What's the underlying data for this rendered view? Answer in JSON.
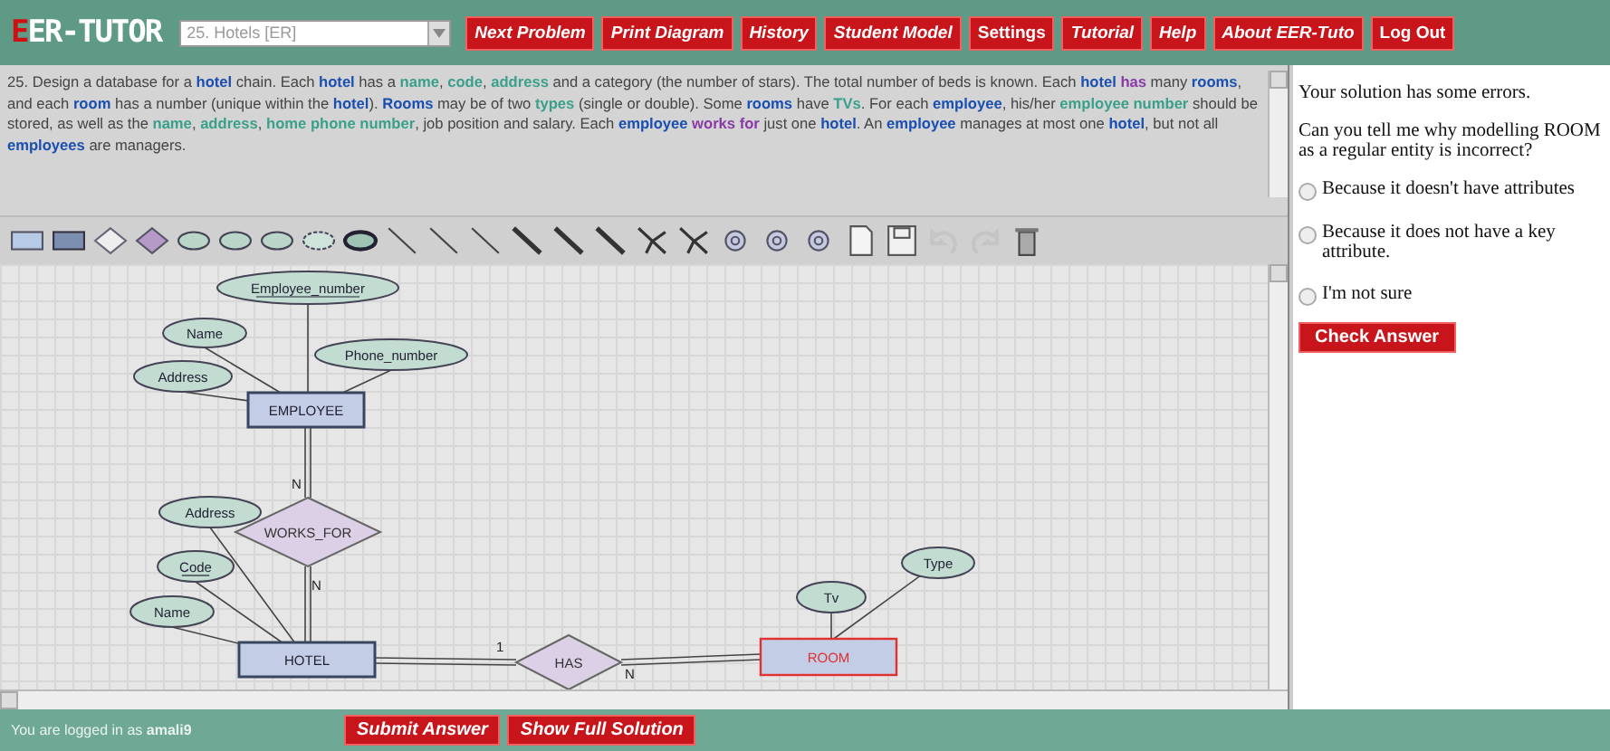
{
  "header": {
    "logo": "EER-TUTOR",
    "problem_select": "25. Hotels [ER]",
    "nav": [
      "Next Problem",
      "Print Diagram",
      "History",
      "Student Model",
      "Settings",
      "Tutorial",
      "Help",
      "About EER-Tuto",
      "Log Out"
    ]
  },
  "problem": {
    "segments": [
      {
        "kind": "plain",
        "text": "25. Design a database for a "
      },
      {
        "kind": "entity",
        "text": "hotel"
      },
      {
        "kind": "plain",
        "text": " chain. Each "
      },
      {
        "kind": "entity",
        "text": "hotel"
      },
      {
        "kind": "plain",
        "text": " has a "
      },
      {
        "kind": "attribute",
        "text": "name"
      },
      {
        "kind": "plain",
        "text": ", "
      },
      {
        "kind": "attribute",
        "text": "code"
      },
      {
        "kind": "plain",
        "text": ", "
      },
      {
        "kind": "attribute",
        "text": "address"
      },
      {
        "kind": "plain",
        "text": " and a category (the number of stars). The total number of beds is known. Each "
      },
      {
        "kind": "entity",
        "text": "hotel"
      },
      {
        "kind": "relationship",
        "text": " has"
      },
      {
        "kind": "plain",
        "text": " many "
      },
      {
        "kind": "entity",
        "text": "rooms"
      },
      {
        "kind": "plain",
        "text": ", and each "
      },
      {
        "kind": "entity",
        "text": "room"
      },
      {
        "kind": "plain",
        "text": " has a number (unique within the "
      },
      {
        "kind": "entity",
        "text": "hotel"
      },
      {
        "kind": "plain",
        "text": "). "
      },
      {
        "kind": "entity",
        "text": "Rooms"
      },
      {
        "kind": "plain",
        "text": " may be of two "
      },
      {
        "kind": "attribute",
        "text": "types"
      },
      {
        "kind": "plain",
        "text": " (single or double). Some "
      },
      {
        "kind": "entity",
        "text": "rooms"
      },
      {
        "kind": "plain",
        "text": " have "
      },
      {
        "kind": "attribute",
        "text": "TVs"
      },
      {
        "kind": "plain",
        "text": ". For each "
      },
      {
        "kind": "entity",
        "text": "employee"
      },
      {
        "kind": "plain",
        "text": ", his/her "
      },
      {
        "kind": "attribute",
        "text": "employee number"
      },
      {
        "kind": "plain",
        "text": " should be stored, as well as the "
      },
      {
        "kind": "attribute",
        "text": "name"
      },
      {
        "kind": "plain",
        "text": ", "
      },
      {
        "kind": "attribute",
        "text": "address"
      },
      {
        "kind": "plain",
        "text": ", "
      },
      {
        "kind": "attribute",
        "text": "home phone number"
      },
      {
        "kind": "plain",
        "text": ", job position and salary. Each "
      },
      {
        "kind": "entity",
        "text": "employee"
      },
      {
        "kind": "relationship",
        "text": " works for"
      },
      {
        "kind": "plain",
        "text": " just one "
      },
      {
        "kind": "entity",
        "text": "hotel"
      },
      {
        "kind": "plain",
        "text": ". An "
      },
      {
        "kind": "entity",
        "text": "employee"
      },
      {
        "kind": "plain",
        "text": " manages at most one "
      },
      {
        "kind": "entity",
        "text": "hotel"
      },
      {
        "kind": "plain",
        "text": ", but not all "
      },
      {
        "kind": "entity",
        "text": "employees"
      },
      {
        "kind": "plain",
        "text": " are managers."
      }
    ]
  },
  "toolbar": [
    {
      "kind": "rect",
      "disabled": false
    },
    {
      "kind": "rect-dark",
      "disabled": false
    },
    {
      "kind": "diamond",
      "disabled": false
    },
    {
      "kind": "diamond-dark",
      "disabled": false
    },
    {
      "kind": "ellipse",
      "disabled": false
    },
    {
      "kind": "ellipse",
      "disabled": false
    },
    {
      "kind": "ellipse",
      "disabled": false
    },
    {
      "kind": "ellipse-dashed",
      "disabled": false
    },
    {
      "kind": "ellipse-dark",
      "disabled": false
    },
    {
      "kind": "line",
      "disabled": false
    },
    {
      "kind": "line",
      "disabled": false
    },
    {
      "kind": "line",
      "disabled": false
    },
    {
      "kind": "line-bold",
      "disabled": false
    },
    {
      "kind": "line-bold",
      "disabled": false
    },
    {
      "kind": "line-bold",
      "disabled": false
    },
    {
      "kind": "fork",
      "disabled": false
    },
    {
      "kind": "fork",
      "disabled": false
    },
    {
      "kind": "circle",
      "disabled": false
    },
    {
      "kind": "circle",
      "disabled": false
    },
    {
      "kind": "circle",
      "disabled": false
    },
    {
      "kind": "new",
      "disabled": false
    },
    {
      "kind": "save",
      "disabled": false
    },
    {
      "kind": "undo",
      "disabled": true
    },
    {
      "kind": "redo",
      "disabled": true
    },
    {
      "kind": "delete",
      "disabled": false
    }
  ],
  "diagram": {
    "entities": [
      {
        "name": "EMPLOYEE",
        "error": false
      },
      {
        "name": "HOTEL",
        "error": false
      },
      {
        "name": "ROOM",
        "error": true
      }
    ],
    "relationships": [
      {
        "name": "WORKS_FOR"
      },
      {
        "name": "HAS"
      }
    ],
    "attributes": [
      {
        "name": "Employee_number",
        "key": true
      },
      {
        "name": "Name",
        "key": false
      },
      {
        "name": "Phone_number",
        "key": false
      },
      {
        "name": "Address",
        "key": false
      },
      {
        "name": "Address",
        "key": false
      },
      {
        "name": "Code",
        "key": true
      },
      {
        "name": "Name",
        "key": false
      },
      {
        "name": "Tv",
        "key": false
      },
      {
        "name": "Type",
        "key": false
      }
    ],
    "cardinalities": [
      "N",
      "N",
      "1",
      "N"
    ]
  },
  "feedback": {
    "message": "Your solution has some errors.",
    "question": "Can you tell me why modelling ROOM as a regular entity is incorrect?",
    "options": [
      {
        "label": "Because it doesn't have attributes",
        "selected": false
      },
      {
        "label": "Because it does not have a key attribute.",
        "selected": false
      },
      {
        "label": "I'm not sure",
        "selected": false
      }
    ],
    "check_button": "Check Answer"
  },
  "footer": {
    "login": "You are logged in as **amali9**",
    "buttons": [
      "Submit Answer",
      "Show Full Solution"
    ]
  }
}
